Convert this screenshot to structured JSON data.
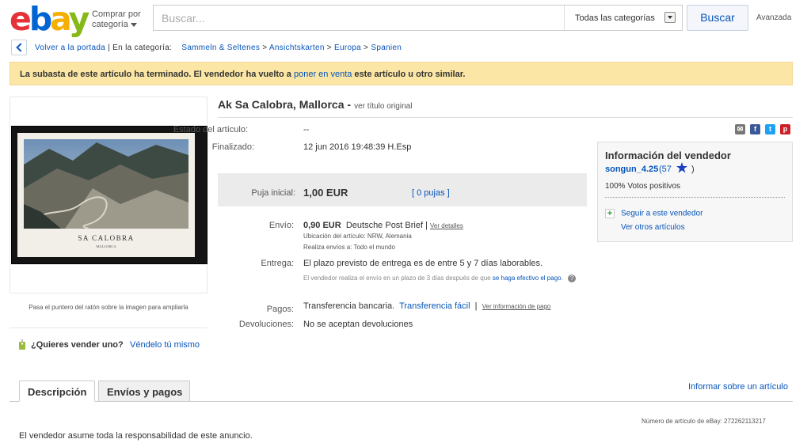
{
  "header": {
    "logo": {
      "e": "e",
      "b": "b",
      "a": "a",
      "y": "y"
    },
    "shop_by_category": "Comprar por",
    "shop_by_category_2": "categoría",
    "search_placeholder": "Buscar...",
    "category_select": "Todas las categorías",
    "search_button": "Buscar",
    "advanced": "Avanzada"
  },
  "breadcrumb": {
    "back": "Volver a la portada",
    "in_category": "En la categoría:",
    "items": [
      "Sammeln & Seltenes",
      "Ansichtskarten",
      "Europa",
      "Spanien"
    ]
  },
  "banner": {
    "text_before": "La subasta de este artículo ha terminado. El vendedor ha vuelto a ",
    "link": "poner en venta",
    "text_after": " este artículo u otro similar."
  },
  "image": {
    "caption": "SA CALOBRA",
    "caption_sub": "MALLORCA",
    "hint": "Pasa el puntero del ratón sobre la imagen para ampliarla"
  },
  "sell": {
    "question": "¿Quieres vender uno?",
    "link": "Véndelo tú mismo"
  },
  "item": {
    "title": "Ak Sa Calobra, Mallorca -",
    "original_title": "ver título original",
    "condition_label": "Estado del artículo:",
    "condition_value": "--",
    "ended_label": "Finalizado:",
    "ended_value": "12 jun 2016  19:48:39 H.Esp",
    "start_bid_label": "Puja inicial:",
    "start_bid_value": "1,00 EUR",
    "bids": "[ 0 pujas ]",
    "shipping_label": "Envío:",
    "shipping_price": "0,90 EUR",
    "shipping_service": "Deutsche Post Brief |",
    "shipping_details": "Ver detalles",
    "location": "Ubicación del artículo:  NRW, Alemania",
    "ships_to": "Realiza envíos a:  Todo el mundo",
    "delivery_label": "Entrega:",
    "delivery_value": "El plazo previsto de entrega es de entre 5 y 7 días laborables.",
    "delivery_note": "El vendedor realiza el envío en un plazo de 3 días después de que",
    "delivery_note_link": "se haga efectivo el pago",
    "delivery_note_end": ".",
    "payments_label": "Pagos:",
    "payments_value": "Transferencia bancaria.",
    "payments_link": "Transferencia fácil",
    "payments_sep": "|",
    "payments_info": "Ver información de pago",
    "returns_label": "Devoluciones:",
    "returns_value": "No se aceptan devoluciones"
  },
  "seller": {
    "heading": "Información del vendedor",
    "name": "songun_4.25",
    "feedback_open": "(57",
    "feedback_close": ")",
    "positive": "100% Votos positivos",
    "follow": "Seguir a este vendedor",
    "other_items": "Ver otros artículos"
  },
  "tabs": [
    "Descripción",
    "Envíos y pagos"
  ],
  "report": "Informar sobre un artículo",
  "item_number": "Número de artículo de eBay:   272262113217",
  "responsibility": "El vendedor asume toda la responsabilidad de este anuncio.",
  "colors": {
    "link": "#0654ba",
    "banner": "#fbe6a5",
    "bid_bg": "#ebebeb",
    "star": "#1a3fbf"
  }
}
